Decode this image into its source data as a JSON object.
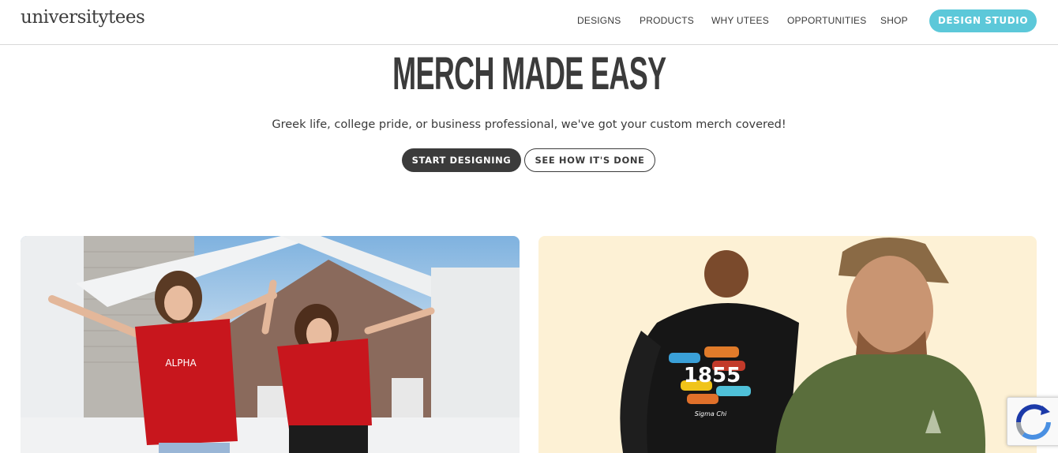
{
  "header": {
    "logo": "universitytees",
    "nav": [
      "DESIGNS",
      "PRODUCTS",
      "WHY UTEES",
      "OPPORTUNITIES",
      "SHOP"
    ],
    "cta": "DESIGN STUDIO"
  },
  "hero": {
    "title": "MERCH MADE EASY",
    "subtitle": "Greek life, college pride, or business professional, we've got your custom merch covered!",
    "primary_button": "START DESIGNING",
    "secondary_button": "SEE HOW IT'S DONE"
  },
  "cards": {
    "left_shirt_text": "ALPHA",
    "right_hoodie_number": "1855",
    "right_hoodie_text": "Sigma Chi"
  },
  "colors": {
    "accent": "#5cc8d9",
    "dark": "#3b3b3b",
    "shirt_red": "#c8161d",
    "right_card_bg": "#fdf1d5"
  }
}
